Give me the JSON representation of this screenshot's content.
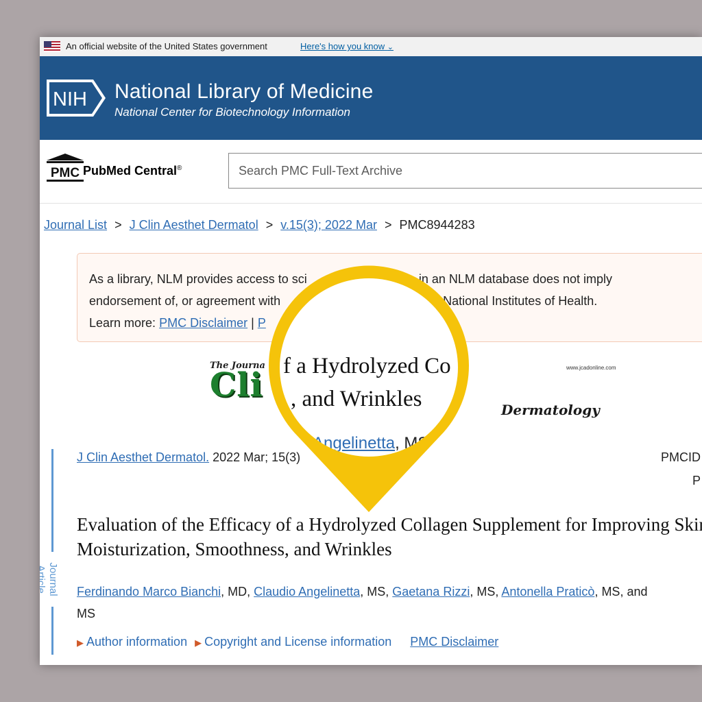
{
  "gov_banner": {
    "text": "An official website of the United States government",
    "link": "Here's how you know",
    "chevron": "⌄"
  },
  "header": {
    "logo_text": "NIH",
    "title": "National Library of Medicine",
    "subtitle": "National Center for Biotechnology Information"
  },
  "pmc": {
    "logo_text": "PMC",
    "name": "PubMed Central",
    "reg": "®",
    "search_placeholder": "Search PMC Full-Text Archive"
  },
  "breadcrumb": {
    "items": [
      "Journal List",
      "J Clin Aesthet Dermatol",
      "v.15(3); 2022 Mar"
    ],
    "current": "PMC8944283",
    "separator": ">"
  },
  "disclaimer": {
    "line1": "As a library, NLM provides access to sci",
    "line1_end": "ture. Inclusion in an NLM database does not imply",
    "line2": "endorsement of, or agreement with",
    "line2_end": "r the National Institutes of Health.",
    "learn_more": "Learn more:",
    "link1": "PMC Disclaimer",
    "pipe": "|",
    "link2": "P"
  },
  "journal_banner": {
    "the_journal": "The Journa",
    "url": "www.jcadonline.com",
    "big_text": "Cli      esthetic",
    "dermatology": "Dermatology"
  },
  "article": {
    "side_label": "Journal Article",
    "journal_link": "J Clin Aesthet Dermatol.",
    "citation_rest": " 2022 Mar; 15(3)",
    "pmcid": "PMCID",
    "p": "P",
    "title": "Evaluation of the Efficacy of a Hydrolyzed Collagen Supplement for Improving Skin Moisturization, Smoothness, and Wrinkles",
    "authors": [
      {
        "name": "Ferdinando Marco Bianchi",
        "suffix": ", MD, "
      },
      {
        "name": "Claudio Angelinetta",
        "suffix": ", MS, "
      },
      {
        "name": "Gaetana Rizzi",
        "suffix": ", MS, "
      },
      {
        "name": "Antonella Praticò",
        "suffix": ", MS, and"
      }
    ],
    "authors_tail": "MS",
    "links": {
      "author_info": "Author information",
      "copyright": "Copyright and License information",
      "disclaimer": "PMC Disclaimer"
    }
  },
  "magnifier": {
    "line1": "f a Hydrolyzed Co",
    "line2": ", and Wrinkles",
    "line3_link": "Angelinetta",
    "line3_rest": ", MS",
    "ring_color": "#f5c30a"
  }
}
